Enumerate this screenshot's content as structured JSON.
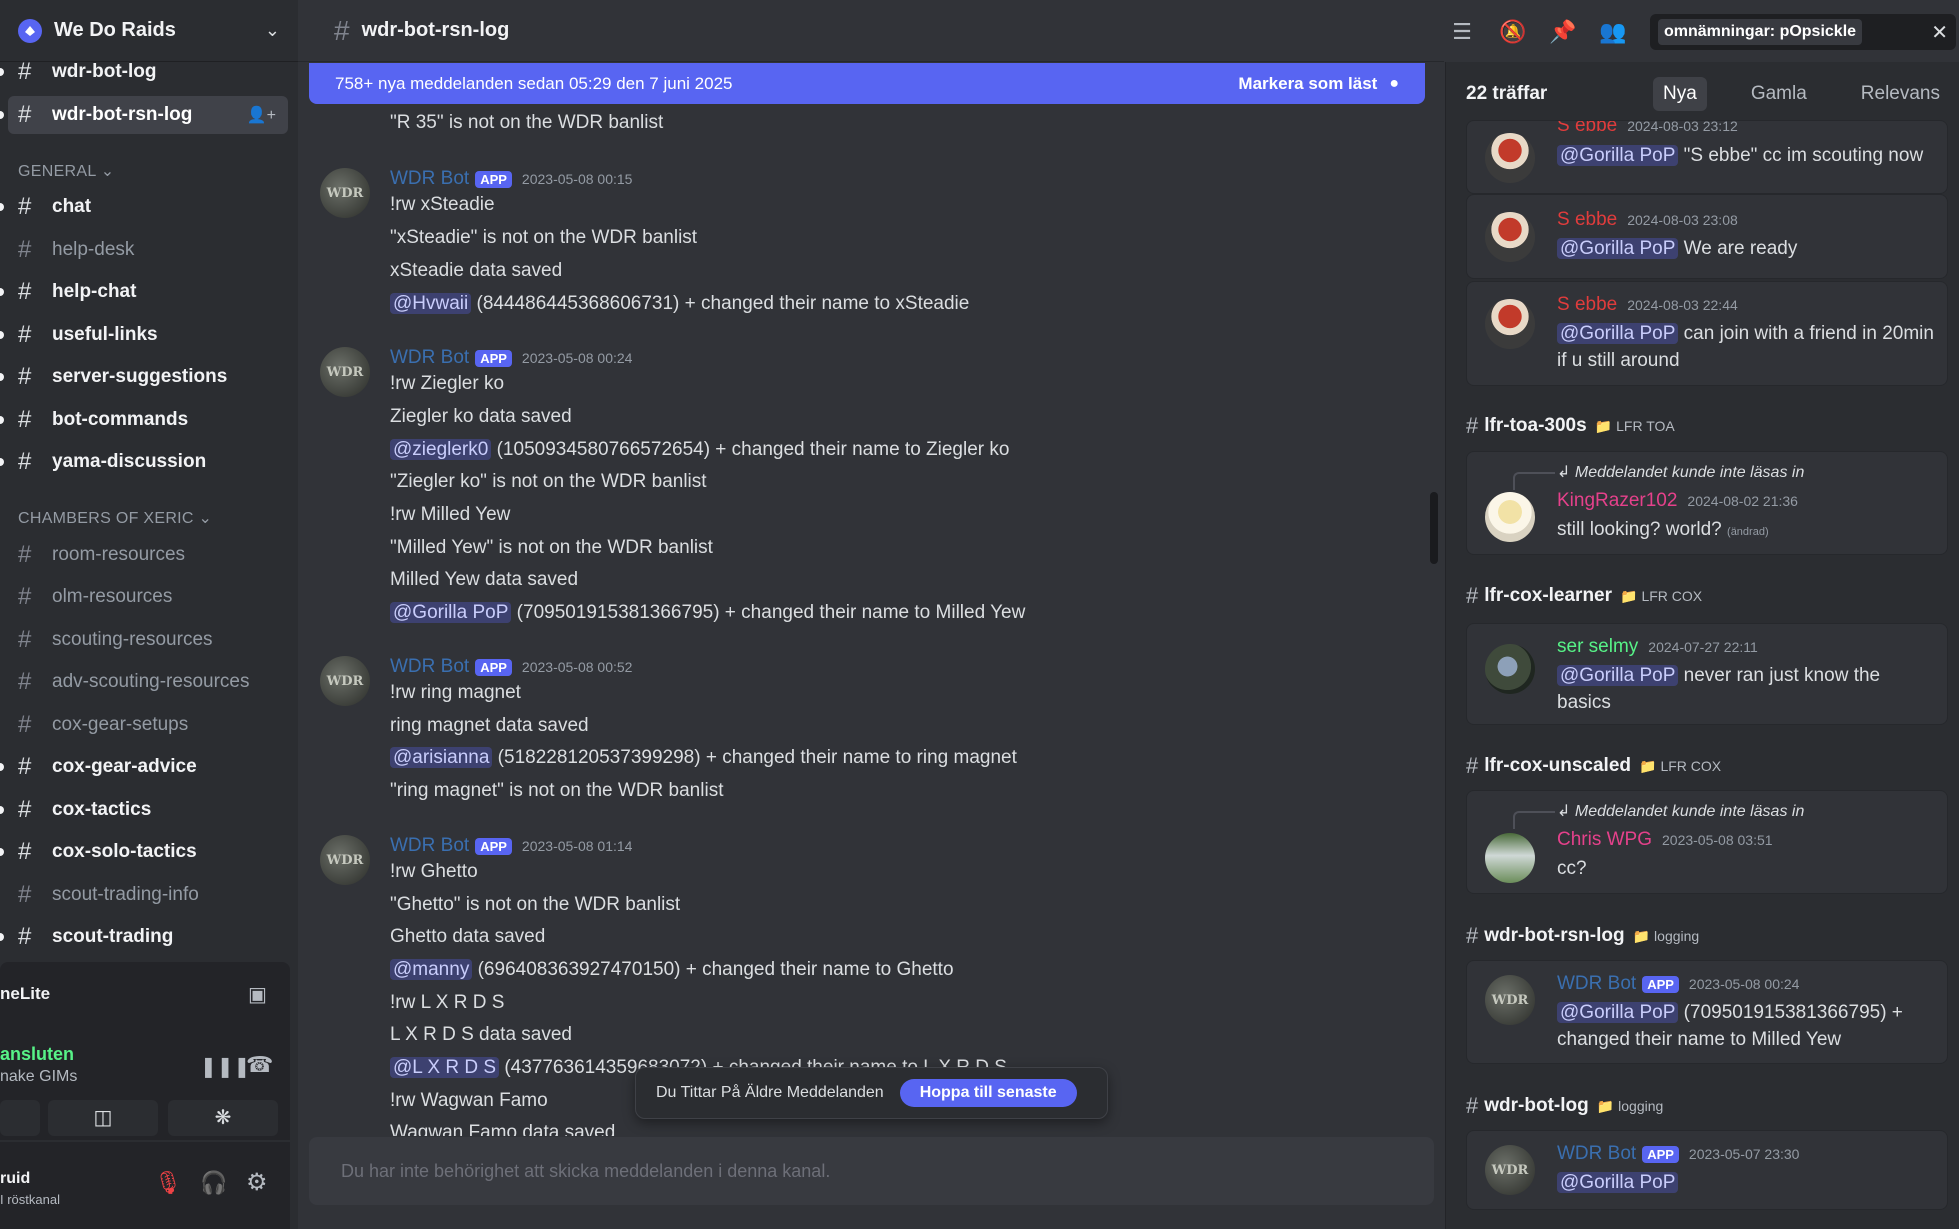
{
  "server": {
    "name": "We Do Raids"
  },
  "sidebar": {
    "channels_top": [
      {
        "name": "wdr-bot-log",
        "unread": true,
        "selected": false
      },
      {
        "name": "wdr-bot-rsn-log",
        "unread": true,
        "selected": true
      }
    ],
    "categories": {
      "general": "GENERAL",
      "cox": "CHAMBERS OF XERIC"
    },
    "general_channels": [
      {
        "name": "chat",
        "unread": true
      },
      {
        "name": "help-desk",
        "unread": false
      },
      {
        "name": "help-chat",
        "unread": true
      },
      {
        "name": "useful-links",
        "unread": true
      },
      {
        "name": "server-suggestions",
        "unread": true
      },
      {
        "name": "bot-commands",
        "unread": true
      },
      {
        "name": "yama-discussion",
        "unread": true
      }
    ],
    "cox_channels": [
      {
        "name": "room-resources",
        "unread": false
      },
      {
        "name": "olm-resources",
        "unread": false
      },
      {
        "name": "scouting-resources",
        "unread": false
      },
      {
        "name": "adv-scouting-resources",
        "unread": false
      },
      {
        "name": "cox-gear-setups",
        "unread": false
      },
      {
        "name": "cox-gear-advice",
        "unread": true
      },
      {
        "name": "cox-tactics",
        "unread": true
      },
      {
        "name": "cox-solo-tactics",
        "unread": true
      },
      {
        "name": "scout-trading-info",
        "unread": false
      },
      {
        "name": "scout-trading",
        "unread": true
      }
    ],
    "voice": {
      "app_name": "neLite",
      "status": "ansluten",
      "channel": "nake GIMs"
    },
    "user": {
      "name": "ruid",
      "status": "I röstkanal"
    }
  },
  "chat": {
    "channel_name": "wdr-bot-rsn-log",
    "banner_text": "758+ nya meddelanden sedan 05:29 den 7 juni 2025",
    "banner_action": "Markera som läst",
    "older_notice": "Du Tittar På Äldre Meddelanden",
    "jump_label": "Hoppa till senaste",
    "composer_placeholder": "Du har inte behörighet att skicka meddelanden i denna kanal.",
    "lead_line": "\"R 35\" is not on the WDR banlist",
    "messages": [
      {
        "author": "WDR Bot",
        "badge": "APP",
        "timestamp": "2023-05-08 00:15",
        "lines": [
          "!rw xSteadie",
          "\"xSteadie\" is not on the WDR banlist",
          "xSteadie data saved"
        ],
        "mention_line": {
          "mention": "@Hvwaii",
          "text": " (844486445368606731) + changed their name to xSteadie"
        }
      },
      {
        "author": "WDR Bot",
        "badge": "APP",
        "timestamp": "2023-05-08 00:24",
        "lines": [
          "!rw Ziegler ko",
          "Ziegler ko data saved"
        ],
        "mention_line": {
          "mention": "@zieglerk0",
          "text": " (1050934580766572654) + changed their name to Ziegler ko"
        },
        "after": [
          "\"Ziegler ko\" is not on the WDR banlist",
          "!rw Milled Yew",
          "\"Milled Yew\" is not on the WDR banlist",
          "Milled Yew data saved"
        ],
        "mention_line2": {
          "mention": "@Gorilla PoP",
          "text": " (709501915381366795) + changed their name to Milled Yew"
        }
      },
      {
        "author": "WDR Bot",
        "badge": "APP",
        "timestamp": "2023-05-08 00:52",
        "lines": [
          "!rw ring magnet",
          "ring magnet data saved"
        ],
        "mention_line": {
          "mention": "@arisianna",
          "text": " (518228120537399298) + changed their name to ring magnet"
        },
        "after": [
          "\"ring magnet\" is not on the WDR banlist"
        ]
      },
      {
        "author": "WDR Bot",
        "badge": "APP",
        "timestamp": "2023-05-08 01:14",
        "lines": [
          "!rw Ghetto",
          "\"Ghetto\" is not on the WDR banlist",
          "Ghetto data saved"
        ],
        "mention_line": {
          "mention": "@manny",
          "text": " (696408363927470150) + changed their name to Ghetto"
        },
        "after": [
          "!rw L X R D S",
          "L X R D S data saved"
        ],
        "mention_line2": {
          "mention": "@L X R D S",
          "text": " (437763614359683072) + changed their name to L X R D S"
        },
        "after2": [
          "!rw Wagwan Famo",
          "Wagwan Famo data saved"
        ]
      }
    ]
  },
  "search": {
    "query_tag": "omnämningar: pOpsickle",
    "result_count": "22 träffar",
    "sort_tabs": [
      "Nya",
      "Gamla",
      "Relevans"
    ],
    "active_sort": "Nya",
    "results": [
      {
        "author": "S ebbe",
        "timestamp": "2024-08-03 23:12",
        "mention": "@Gorilla PoP",
        "text": " \"S ebbe\" cc im scouting now"
      },
      {
        "author": "S ebbe",
        "timestamp": "2024-08-03 23:08",
        "mention": "@Gorilla PoP",
        "text": " We are ready"
      },
      {
        "author": "S ebbe",
        "timestamp": "2024-08-03 22:44",
        "mention": "@Gorilla PoP",
        "text": " can join with a friend in 20min if u still around"
      }
    ],
    "groups": [
      {
        "channel": "lfr-toa-300s",
        "category": "LFR TOA",
        "reply": "Meddelandet kunde inte läsas in",
        "author": "KingRazer102",
        "timestamp": "2024-08-02 21:36",
        "text": "still looking? world?",
        "edited": "(ändrad)"
      },
      {
        "channel": "lfr-cox-learner",
        "category": "LFR COX",
        "author": "ser selmy",
        "timestamp": "2024-07-27 22:11",
        "mention": "@Gorilla PoP",
        "text": " never ran just know the basics"
      },
      {
        "channel": "lfr-cox-unscaled",
        "category": "LFR COX",
        "reply": "Meddelandet kunde inte läsas in",
        "author": "Chris WPG",
        "timestamp": "2023-05-08 03:51",
        "text": "cc?"
      },
      {
        "channel": "wdr-bot-rsn-log",
        "category": "logging",
        "author": "WDR Bot",
        "badge": "APP",
        "timestamp": "2023-05-08 00:24",
        "mention": "@Gorilla PoP",
        "text": " (709501915381366795) + changed their name to Milled Yew"
      },
      {
        "channel": "wdr-bot-log",
        "category": "logging",
        "author": "WDR Bot",
        "badge": "APP",
        "timestamp": "2023-05-07 23:30",
        "mention": "@Gorilla PoP",
        "text": ""
      }
    ]
  },
  "avatar_text": "WDR",
  "colors": {
    "accent": "#5865f2",
    "bot_name": "#3a6fb0",
    "sebbe": "#e03c3c",
    "king": "#e5418b",
    "selmy": "#57f287"
  }
}
